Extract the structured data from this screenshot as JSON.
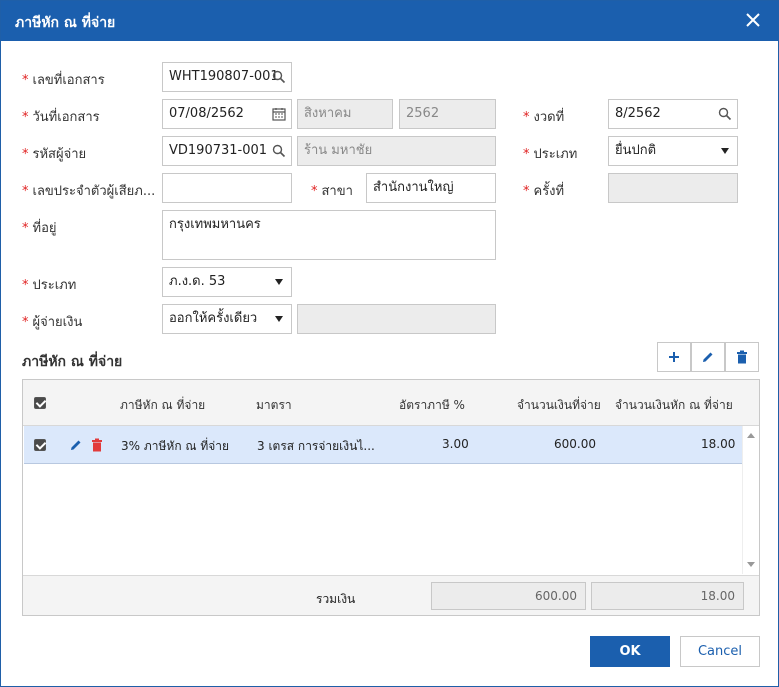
{
  "dialog": {
    "title": "ภาษีหัก ณ ที่จ่าย"
  },
  "form": {
    "doc_no": {
      "label": "เลขที่เอกสาร",
      "value": "WHT190807-001"
    },
    "doc_date": {
      "label": "วันที่เอกสาร",
      "value": "07/08/2562",
      "month": "สิงหาคม",
      "year": "2562"
    },
    "period": {
      "label": "งวดที่",
      "value": "8/2562"
    },
    "payer_code": {
      "label": "รหัสผู้จ่าย",
      "value": "VD190731-001",
      "name": "ร้าน มหาชัย"
    },
    "filing_type": {
      "label": "ประเภท",
      "value": "ยื่นปกติ"
    },
    "tax_id": {
      "label": "เลขประจำตัวผู้เสียภ...",
      "value": ""
    },
    "branch": {
      "label": "สาขา",
      "value": "สำนักงานใหญ่"
    },
    "times": {
      "label": "ครั้งที่",
      "value": ""
    },
    "address": {
      "label": "ที่อยู่",
      "value": "กรุงเทพมหานคร"
    },
    "form_type": {
      "label": "ประเภท",
      "value": "ภ.ง.ด. 53"
    },
    "payer": {
      "label": "ผู้จ่ายเงิน",
      "value": "ออกให้ครั้งเดียว",
      "extra": ""
    }
  },
  "section": {
    "title": "ภาษีหัก ณ ที่จ่าย"
  },
  "grid": {
    "columns": [
      "ภาษีหัก ณ ที่จ่าย",
      "มาตรา",
      "อัตราภาษี %",
      "จำนวนเงินที่จ่าย",
      "จำนวนเงินหัก ณ ที่จ่าย"
    ],
    "rows": [
      {
        "tax": "3% ภาษีหัก ณ ที่จ่าย",
        "section": "3 เตรส การจ่ายเงินไ...",
        "rate": "3.00",
        "amount": "600.00",
        "withheld": "18.00"
      }
    ],
    "footer": {
      "label": "รวมเงิน",
      "total_amount": "600.00",
      "total_withheld": "18.00"
    }
  },
  "buttons": {
    "ok": "OK",
    "cancel": "Cancel"
  },
  "colors": {
    "primary": "#1b5fae",
    "required": "#e02020",
    "delete": "#e23b3b",
    "selected_row": "#dbe8fb"
  }
}
